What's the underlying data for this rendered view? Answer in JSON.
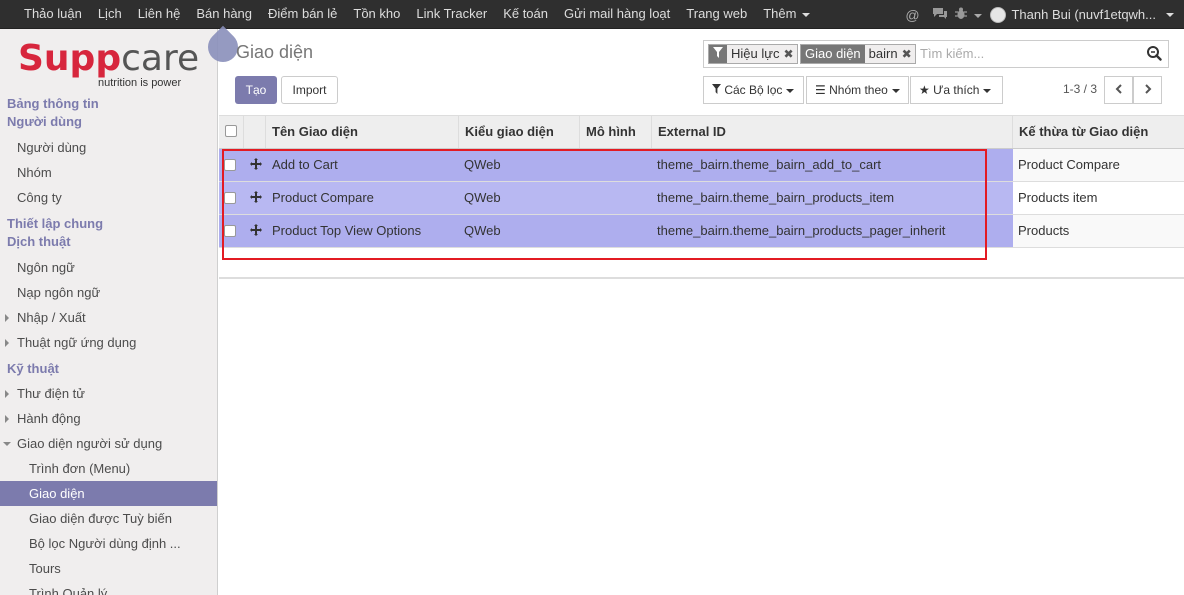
{
  "topbar": {
    "menu": [
      "Thảo luận",
      "Lịch",
      "Liên hệ",
      "Bán hàng",
      "Điểm bán lẻ",
      "Tồn kho",
      "Link Tracker",
      "Kế toán",
      "Gửi mail hàng loạt",
      "Trang web",
      "Thêm"
    ],
    "user_name": "Thanh Bui (nuvf1etqwh..."
  },
  "sidebar": {
    "logo_brand_red": "Supp",
    "logo_brand_gray": "care",
    "logo_tagline": "nutrition is power",
    "sections": [
      {
        "header": "Bảng thông tin"
      },
      {
        "header": "Người dùng",
        "items": [
          "Người dùng",
          "Nhóm",
          "Công ty"
        ]
      },
      {
        "header": "Thiết lập chung"
      },
      {
        "header": "Dịch thuật",
        "items": [
          "Ngôn ngữ",
          "Nạp ngôn ngữ",
          "Nhập / Xuất",
          "Thuật ngữ ứng dụng"
        ]
      },
      {
        "header": "Kỹ thuật",
        "items": [
          "Thư điện tử",
          "Hành động",
          "Giao diện người sử dụng"
        ]
      }
    ],
    "subitems": [
      "Trình đơn (Menu)",
      "Giao diện",
      "Giao diện được Tuỳ biến",
      "Bộ lọc Người dùng định ...",
      "Tours",
      "Trình Quản lý..."
    ]
  },
  "control": {
    "title": "Giao diện",
    "create_label": "Tạo",
    "import_label": "Import",
    "facet1": "Hiệu lực",
    "facet2_key": "Giao diện",
    "facet2_value": "bairn",
    "search_placeholder": "Tìm kiếm...",
    "filters_label": "Các Bộ lọc",
    "groupby_label": "Nhóm theo",
    "favorites_label": "Ưa thích",
    "pager": "1-3 / 3"
  },
  "table": {
    "headers": [
      "Tên Giao diện",
      "Kiểu giao diện",
      "Mô hình",
      "External ID",
      "Kế thừa từ Giao diện"
    ],
    "rows": [
      {
        "name": "Add to Cart",
        "type": "QWeb",
        "model": "",
        "external_id": "theme_bairn.theme_bairn_add_to_cart",
        "inherit": "Product Compare"
      },
      {
        "name": "Product Compare",
        "type": "QWeb",
        "model": "",
        "external_id": "theme_bairn.theme_bairn_products_item",
        "inherit": "Products item"
      },
      {
        "name": "Product Top View Options",
        "type": "QWeb",
        "model": "",
        "external_id": "theme_bairn.theme_bairn_products_pager_inherit",
        "inherit": "Products"
      }
    ]
  },
  "colors": {
    "accent": "#7c7bad",
    "highlight": "#aeaeee",
    "annotation": "#e31b23"
  }
}
